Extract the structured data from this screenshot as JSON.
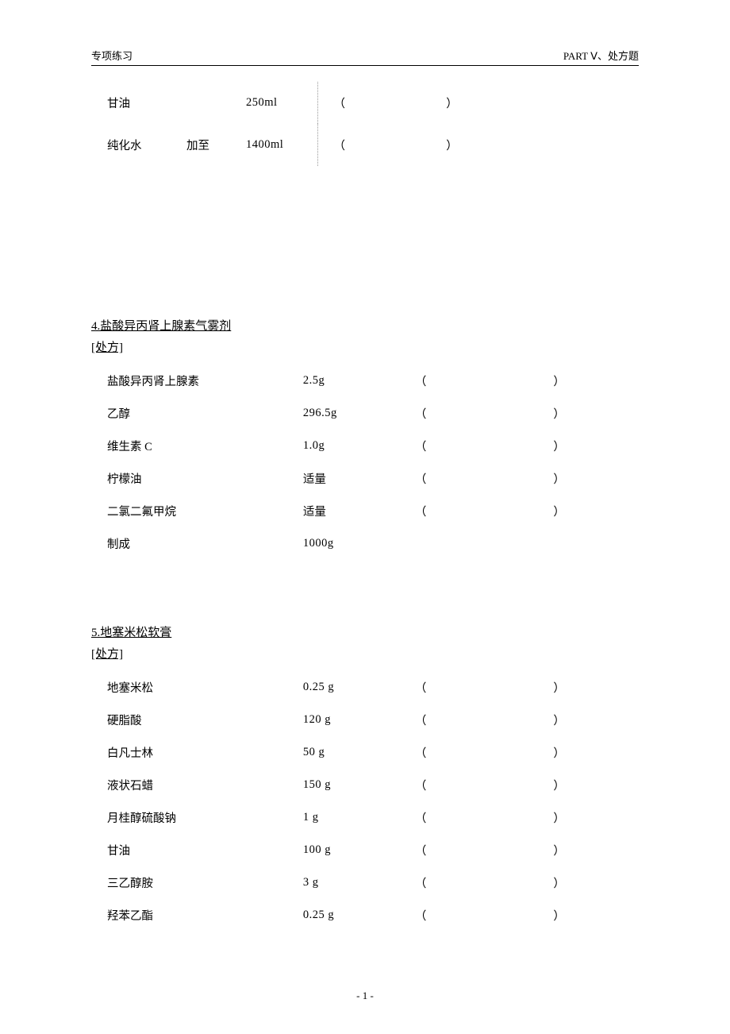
{
  "header": {
    "left": "专项练习",
    "right": "PART Ⅴ、处方题"
  },
  "block1": {
    "rows": [
      {
        "name": "甘油",
        "mid": "",
        "qty": "250ml",
        "lp": "（",
        "rp": "）"
      },
      {
        "name": "纯化水",
        "mid": "加至",
        "qty": "1400ml",
        "lp": "（",
        "rp": "）"
      }
    ]
  },
  "section4": {
    "title": "4.盐酸异丙肾上腺素气雾剂",
    "sub": "[处方]",
    "rows": [
      {
        "name": "盐酸异丙肾上腺素",
        "qty": "2.5g",
        "lp": "（",
        "rp": "）"
      },
      {
        "name": "乙醇",
        "qty": "296.5g",
        "lp": "（",
        "rp": "）"
      },
      {
        "name": "维生素 C",
        "qty": "1.0g",
        "lp": "（",
        "rp": "）"
      },
      {
        "name": "柠檬油",
        "qty": "适量",
        "lp": "（",
        "rp": "）"
      },
      {
        "name": "二氯二氟甲烷",
        "qty": "适量",
        "lp": "（",
        "rp": "）"
      },
      {
        "name": "制成",
        "qty": "1000g",
        "lp": "",
        "rp": ""
      }
    ]
  },
  "section5": {
    "title": "5.地塞米松软膏",
    "sub": "[处方]",
    "rows": [
      {
        "name": "地塞米松",
        "qty": "0.25 g",
        "lp": "（",
        "rp": "）"
      },
      {
        "name": "硬脂酸",
        "qty": "120 g",
        "lp": "（",
        "rp": "）"
      },
      {
        "name": "白凡士林",
        "qty": "50 g",
        "lp": "（",
        "rp": "）"
      },
      {
        "name": "液状石蜡",
        "qty": "150 g",
        "lp": "（",
        "rp": "）"
      },
      {
        "name": "月桂醇硫酸钠",
        "qty": "1 g",
        "lp": "（",
        "rp": "）"
      },
      {
        "name": "甘油",
        "qty": "100 g",
        "lp": "（",
        "rp": "）"
      },
      {
        "name": "三乙醇胺",
        "qty": "3 g",
        "lp": "（",
        "rp": "）"
      },
      {
        "name": "羟苯乙酯",
        "qty": "0.25 g",
        "lp": "（",
        "rp": "）"
      }
    ]
  },
  "footer": "- 1 -"
}
